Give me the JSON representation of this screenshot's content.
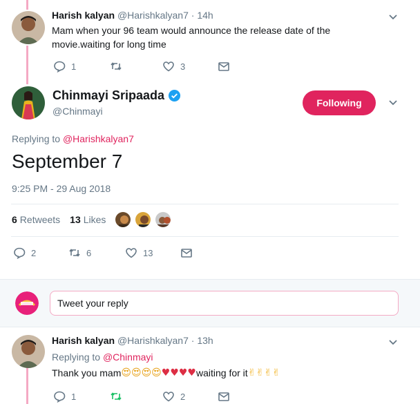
{
  "colors": {
    "accent": "#e0245e",
    "thread_line": "#f4a9c4",
    "muted": "#657786",
    "retweet_active": "#17bf63"
  },
  "tweet_top": {
    "name": "Harish kalyan",
    "handle": "@Harishkalyan7",
    "time": "· 14h",
    "text": "Mam when your 96 team would announce the release date of the movie.waiting for long time",
    "replies": "1",
    "retweets": "",
    "likes": "3"
  },
  "main_tweet": {
    "name": "Chinmayi Sripaada",
    "handle": "@Chinmayi",
    "follow_label": "Following",
    "replying_label": "Replying to",
    "replying_to": "@Harishkalyan7",
    "text": "September 7",
    "timestamp": "9:25 PM - 29 Aug 2018",
    "retweets_count": "6",
    "retweets_label": "Retweets",
    "likes_count": "13",
    "likes_label": "Likes",
    "replies": "2",
    "retweets": "6",
    "likes": "13"
  },
  "reply_box": {
    "placeholder": "Tweet your reply"
  },
  "tweet_bottom": {
    "name": "Harish kalyan",
    "handle": "@Harishkalyan7",
    "time": "· 13h",
    "replying_label": "Replying to",
    "replying_to": "@Chinmayi",
    "text_before": "Thank you mam",
    "emojis_love": "😍😍😍😍",
    "emojis_hearts": "♥♥♥♥",
    "text_mid": "waiting for it",
    "emojis_hands": "✌✌✌✌",
    "replies": "1",
    "retweets": "",
    "likes": "2"
  },
  "icons": [
    "chevron-down-icon",
    "reply-icon",
    "retweet-icon",
    "like-icon",
    "message-icon",
    "verified-icon"
  ]
}
